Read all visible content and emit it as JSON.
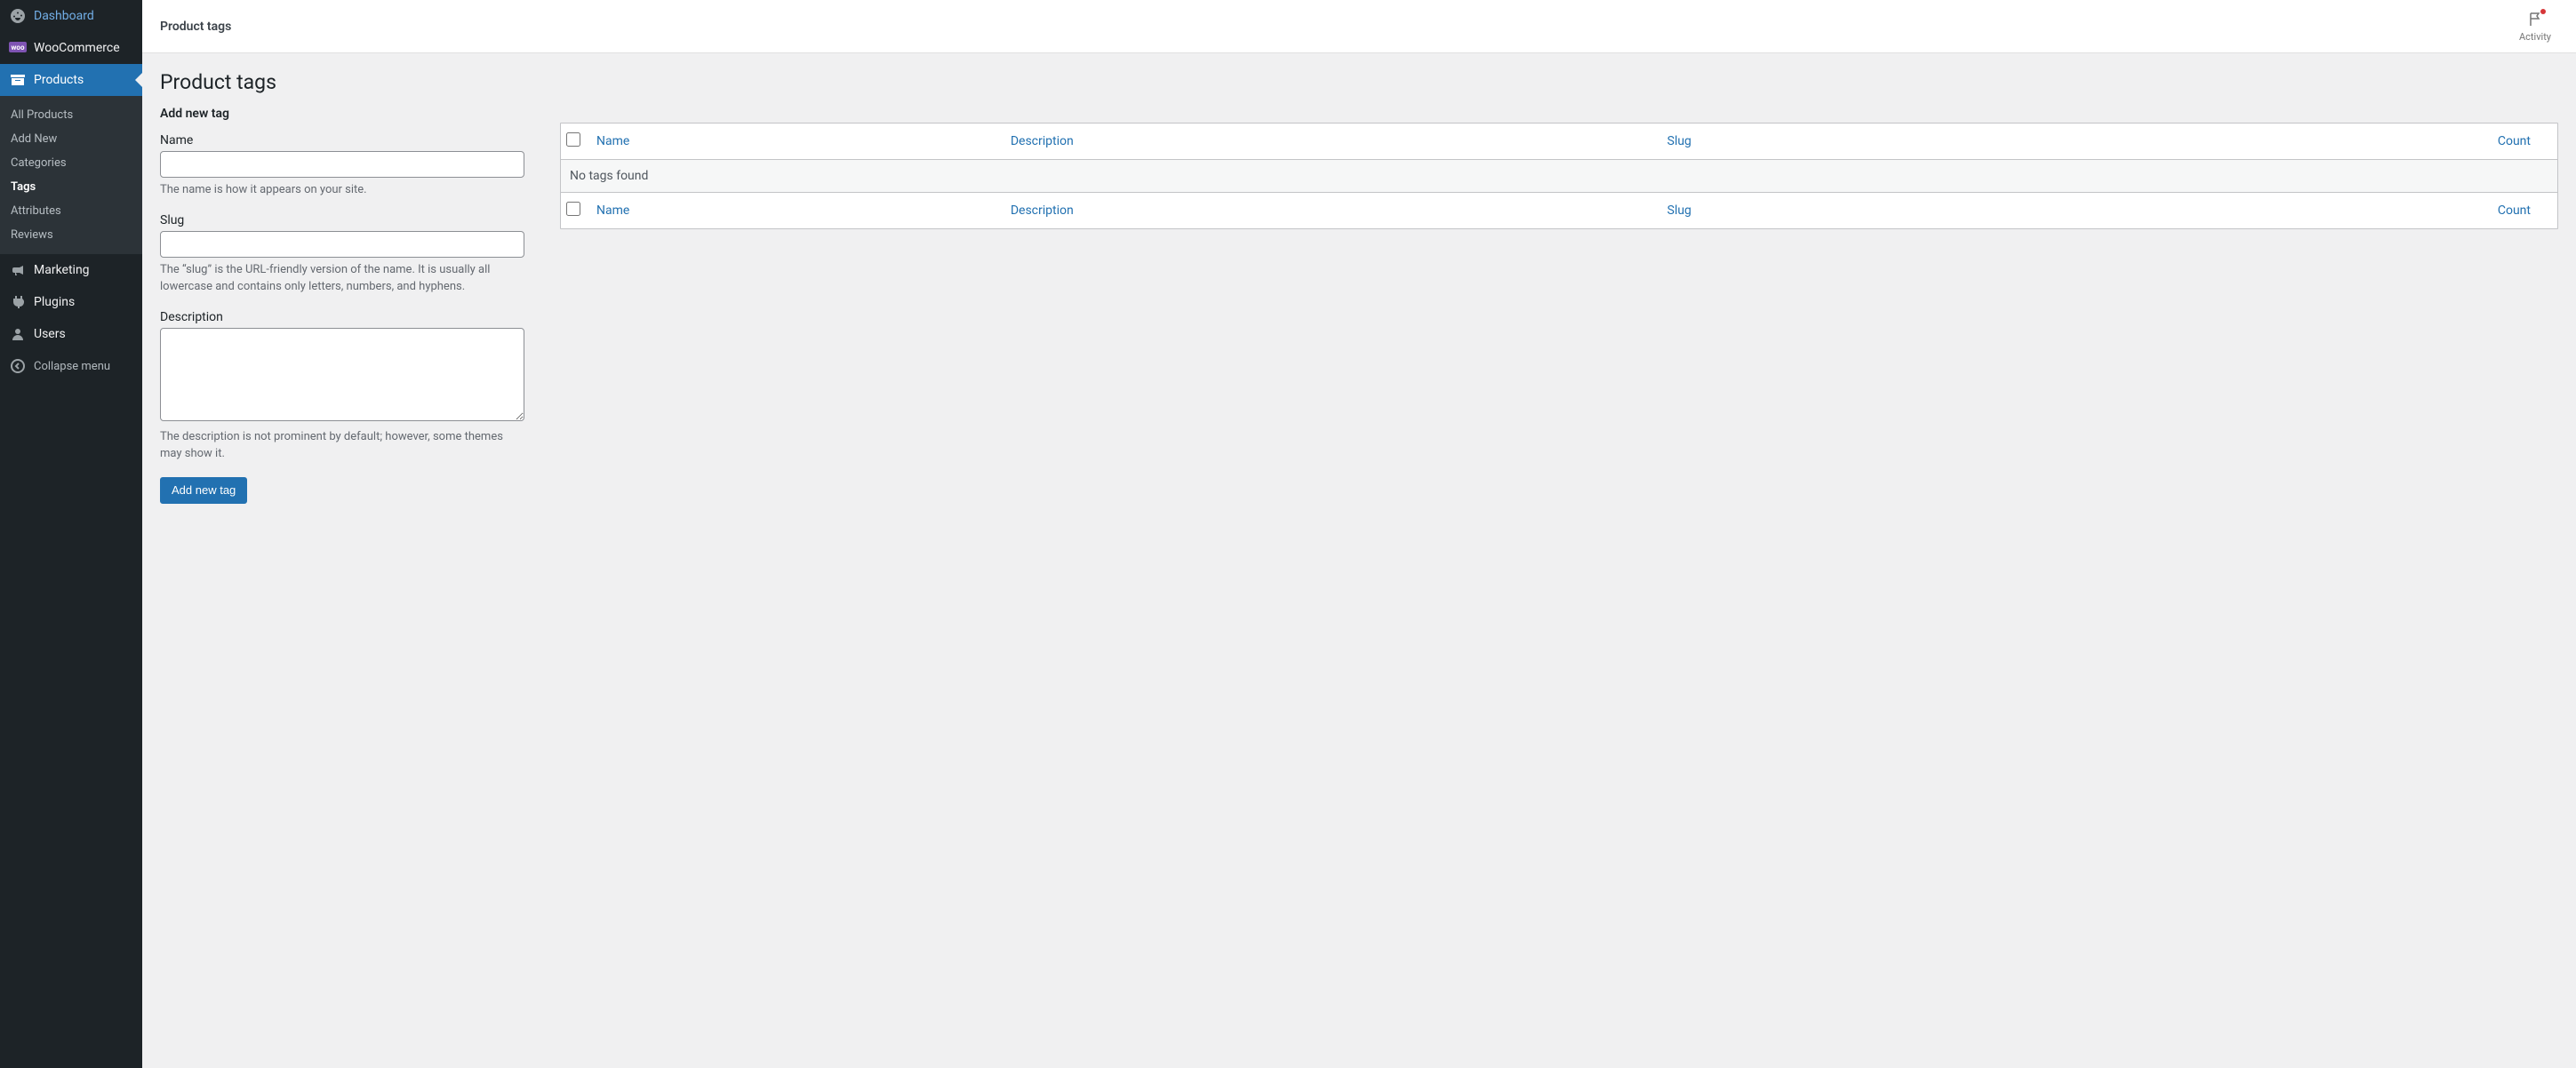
{
  "sidebar": {
    "items": [
      {
        "label": "Dashboard",
        "icon": "dashboard"
      },
      {
        "label": "WooCommerce",
        "icon": "woo"
      },
      {
        "label": "Products",
        "icon": "archive"
      },
      {
        "label": "Marketing",
        "icon": "megaphone"
      },
      {
        "label": "Plugins",
        "icon": "plug"
      },
      {
        "label": "Users",
        "icon": "user"
      }
    ],
    "submenu": {
      "all_products": "All Products",
      "add_new": "Add New",
      "categories": "Categories",
      "tags": "Tags",
      "attributes": "Attributes",
      "reviews": "Reviews"
    },
    "collapse": "Collapse menu"
  },
  "topbar": {
    "title": "Product tags",
    "activity": "Activity"
  },
  "page": {
    "title": "Product tags"
  },
  "form": {
    "heading": "Add new tag",
    "name_label": "Name",
    "name_help": "The name is how it appears on your site.",
    "slug_label": "Slug",
    "slug_help": "The “slug” is the URL-friendly version of the name. It is usually all lowercase and contains only letters, numbers, and hyphens.",
    "description_label": "Description",
    "description_help": "The description is not prominent by default; however, some themes may show it.",
    "submit": "Add new tag"
  },
  "table": {
    "columns": {
      "name": "Name",
      "description": "Description",
      "slug": "Slug",
      "count": "Count"
    },
    "empty": "No tags found"
  }
}
